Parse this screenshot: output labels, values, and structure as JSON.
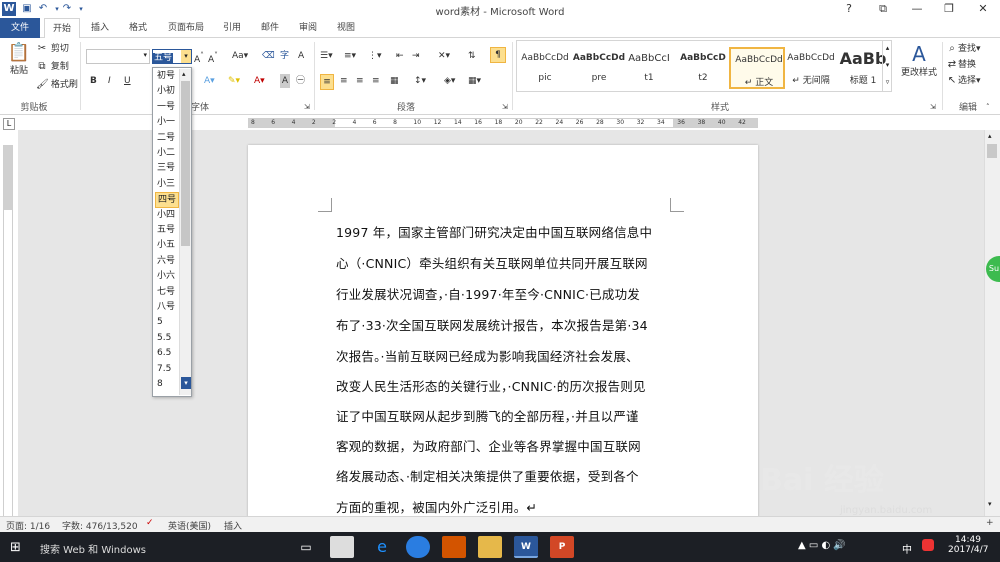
{
  "window": {
    "title": "word素材 - Microsoft Word",
    "controls": [
      "?",
      "⧉",
      "—",
      "❐",
      "✕"
    ]
  },
  "tabs": [
    "文件",
    "开始",
    "插入",
    "格式",
    "页面布局",
    "引用",
    "邮件",
    "审阅",
    "视图"
  ],
  "clipboard": {
    "paste": "粘贴",
    "cut": "剪切",
    "copy": "复制",
    "format_painter": "格式刷",
    "group": "剪贴板"
  },
  "font": {
    "name_value": "",
    "size_value": "五号",
    "group": "字体",
    "bold": "B",
    "italic": "I",
    "underline": "U"
  },
  "paragraph": {
    "group": "段落"
  },
  "styles": {
    "group": "样式",
    "items": [
      {
        "sample": "AaBbCcDd",
        "name": "pic"
      },
      {
        "sample": "AaBbCcDd",
        "name": "pre"
      },
      {
        "sample": "AaBbCcI",
        "name": "t1"
      },
      {
        "sample": "AaBbCcD",
        "name": "t2"
      },
      {
        "sample": "AaBbCcDd",
        "name": "↵ 正文"
      },
      {
        "sample": "AaBbCcDd",
        "name": "↵ 无间隔"
      },
      {
        "sample": "AaBb",
        "name": "标题 1"
      }
    ],
    "change_styles": "更改样式"
  },
  "editing": {
    "group": "编辑",
    "find": "查找",
    "replace": "替换",
    "select": "选择"
  },
  "font_sizes": [
    "初号",
    "小初",
    "一号",
    "小一",
    "二号",
    "小二",
    "三号",
    "小三",
    "四号",
    "小四",
    "五号",
    "小五",
    "六号",
    "小六",
    "七号",
    "八号",
    "5",
    "5.5",
    "6.5",
    "7.5",
    "8"
  ],
  "font_size_highlight": "四号",
  "ruler_numbers": [
    "8",
    "6",
    "4",
    "2",
    "2",
    "4",
    "6",
    "8",
    "10",
    "12",
    "14",
    "16",
    "18",
    "20",
    "22",
    "24",
    "26",
    "28",
    "30",
    "32",
    "34",
    "36",
    "38",
    "40",
    "42"
  ],
  "document": {
    "lines": [
      "1997 年，国家主管部门研究决定由中国互联网络信息中",
      "心（·CNNIC）牵头组织有关互联网单位共同开展互联网",
      "行业发展状况调查，·自·1997·年至今·CNNIC·已成功发",
      "布了·33·次全国互联网发展统计报告，本次报告是第·34",
      "次报告。·当前互联网已经成为影响我国经济社会发展、",
      "改变人民生活形态的关键行业，·CNNIC·的历次报告则见",
      "证了中国互联网从起步到腾飞的全部历程，·并且以严谨",
      "客观的数据，为政府部门、企业等各界掌握中国互联网",
      "络发展动态、·制定相关决策提供了重要依据，受到各个",
      "方面的重视，被国内外广泛引用。↵"
    ]
  },
  "status": {
    "page": "页面: 1/16",
    "words": "字数: 476/13,520",
    "language": "英语(美国)",
    "mode": "插入",
    "zoom": "+"
  },
  "taskbar": {
    "search_placeholder": "搜索 Web 和 Windows",
    "time": "14:49",
    "date": "2017/4/7",
    "ime": "中"
  },
  "watermark": {
    "text": "Bai 经验",
    "url": "jingyan.baidu.com"
  },
  "side_badge": "Su"
}
